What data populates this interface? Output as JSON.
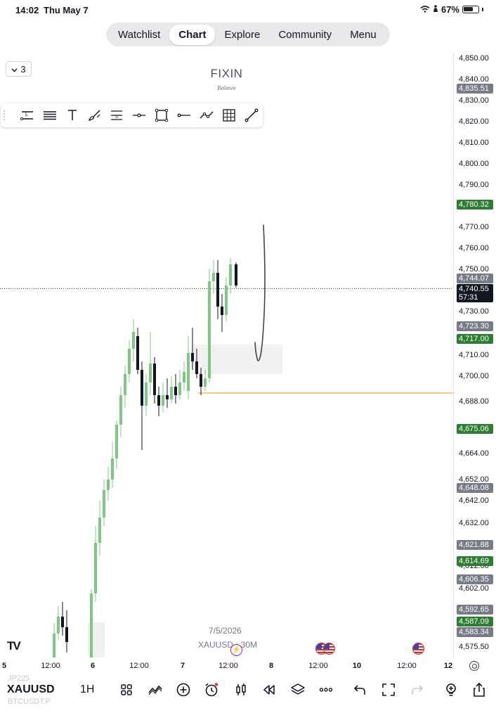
{
  "status": {
    "time": "14:02",
    "date": "Thu May 7",
    "battery": "67%"
  },
  "nav": {
    "tabs": [
      "Watchlist",
      "Chart",
      "Explore",
      "Community",
      "Menu"
    ],
    "active": "Chart"
  },
  "layout_picker": {
    "value": "3"
  },
  "watermark": {
    "title": "FIXIN",
    "subtitle": "Believe"
  },
  "drawing_tools": [
    "trend-label-icon",
    "horizontal-lines-icon",
    "text-icon",
    "brush-icon",
    "fib-icon",
    "horizontal-ray-icon",
    "rectangle-icon",
    "horizontal-line-icon",
    "path-icon",
    "grid-icon",
    "trend-line-icon"
  ],
  "price_axis": {
    "ticks": [
      "4,850.00",
      "4,840.00",
      "4,830.00",
      "4,820.00",
      "4,810.00",
      "4,800.00",
      "4,790.00",
      "4,770.00",
      "4,760.00",
      "4,750.00",
      "4,730.00",
      "4,710.00",
      "4,700.00",
      "4,688.00",
      "4,664.00",
      "4,652.00",
      "4,642.00",
      "4,632.00",
      "4,612.00",
      "4,602.00",
      "4,575.50"
    ],
    "badges": [
      {
        "price": "4,835.51",
        "color": "#787b86"
      },
      {
        "price": "4,780.32",
        "color": "#2e7d32"
      },
      {
        "price": "4,744.07",
        "color": "#787b86"
      },
      {
        "price": "4,740.55",
        "countdown": "57:31",
        "color": "#131722"
      },
      {
        "price": "4,723.30",
        "color": "#787b86"
      },
      {
        "price": "4,717.00",
        "color": "#2e7d32"
      },
      {
        "price": "4,675.06",
        "color": "#2e7d32"
      },
      {
        "price": "4,648.08",
        "color": "#787b86"
      },
      {
        "price": "4,621.88",
        "color": "#787b86"
      },
      {
        "price": "4,614.69",
        "color": "#2e7d32"
      },
      {
        "price": "4,606.35",
        "color": "#787b86"
      },
      {
        "price": "4,592.65",
        "color": "#787b86"
      },
      {
        "price": "4,587.09",
        "color": "#2e7d32"
      },
      {
        "price": "4,583.34",
        "color": "#787b86"
      }
    ]
  },
  "time_axis": {
    "ticks": [
      "5",
      "12:00",
      "6",
      "12:00",
      "7",
      "12:00",
      "8",
      "12:00",
      "10",
      "12:00",
      "12"
    ]
  },
  "chart_overlay": {
    "date": "7/5/2026",
    "pair": "XAUUSD · 30M"
  },
  "bottom_bar": {
    "symbol": "XAUUSD",
    "symbol_prev": "JP225",
    "symbol_next": "BTCUSDT.P",
    "interval": "1H",
    "icons": [
      "apps-icon",
      "indicators-icon",
      "add-icon",
      "alert-icon",
      "candles-icon",
      "replay-icon",
      "layers-icon",
      "more-icon",
      "undo-icon",
      "fullscreen-icon",
      "redo-icon",
      "bulb-icon",
      "share-icon"
    ]
  },
  "colors": {
    "up": "#81c784",
    "down": "#131722",
    "accent_green": "#2e7d32"
  }
}
